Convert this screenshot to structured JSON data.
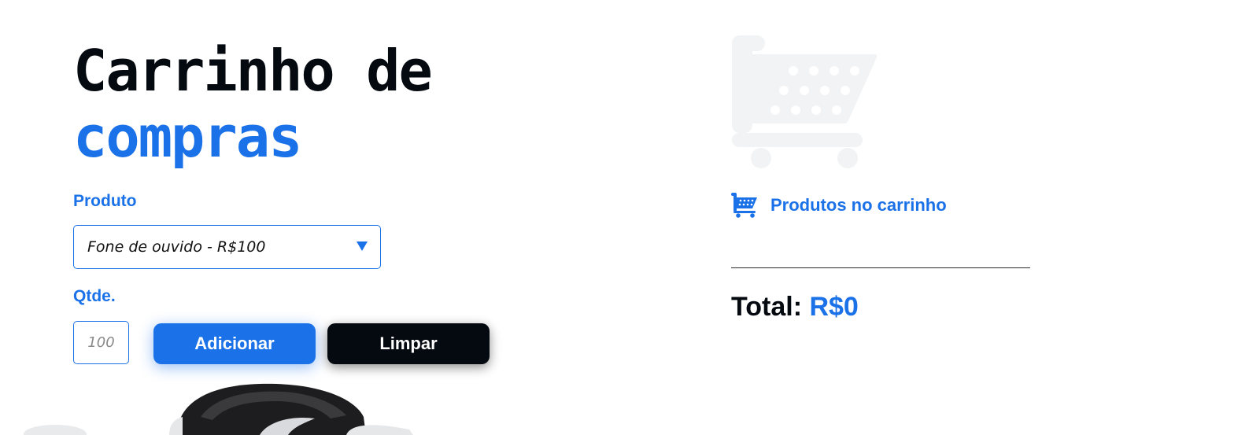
{
  "title": {
    "line1": "Carrinho de",
    "line2": "compras"
  },
  "form": {
    "product_label": "Produto",
    "product_selected": "Fone de ouvido - R$100",
    "qty_label": "Qtde.",
    "qty_placeholder": "100",
    "add_label": "Adicionar",
    "clear_label": "Limpar"
  },
  "cart": {
    "header": "Produtos no carrinho",
    "total_label": "Total:",
    "total_value": "R$0"
  },
  "icons": [
    "cart-watermark-icon",
    "shopping-cart-icon",
    "chevron-down-icon"
  ],
  "colors": {
    "accent": "#1b72e8",
    "dark": "#050a10",
    "watermark": "#f2f3f4"
  }
}
